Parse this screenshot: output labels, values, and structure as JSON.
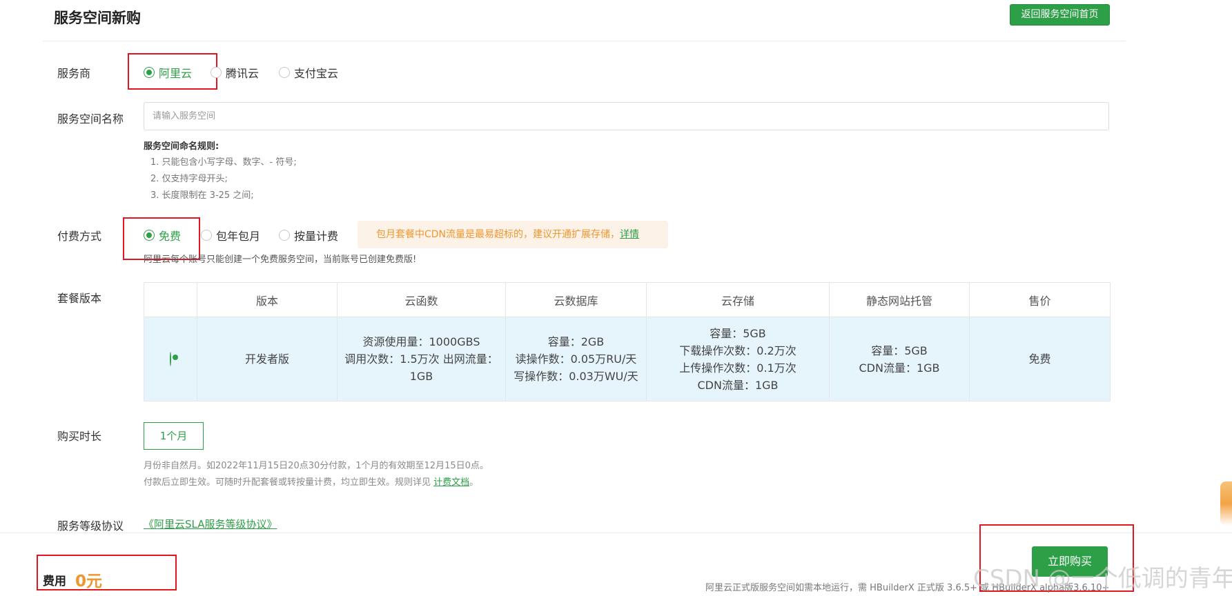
{
  "header": {
    "title": "服务空间新购",
    "back_button": "返回服务空间首页"
  },
  "provider": {
    "label": "服务商",
    "options": [
      "阿里云",
      "腾讯云",
      "支付宝云"
    ],
    "selected": "阿里云"
  },
  "space_name": {
    "label": "服务空间名称",
    "placeholder": "请输入服务空间",
    "value": "",
    "rules_title": "服务空间命名规则:",
    "rules": [
      "1. 只能包含小写字母、数字、- 符号;",
      "2. 仅支持字母开头;",
      "3. 长度限制在 3-25 之间;"
    ]
  },
  "payment": {
    "label": "付费方式",
    "options": [
      "免费",
      "包年包月",
      "按量计费"
    ],
    "selected": "免费",
    "notice": "包月套餐中CDN流量是最易超标的，建议开通扩展存储，",
    "notice_link": "详情",
    "note": "阿里云每个账号只能创建一个免费服务空间，当前账号已创建免费版!"
  },
  "plans": {
    "label": "套餐版本",
    "headers": [
      "",
      "版本",
      "云函数",
      "云数据库",
      "云存储",
      "静态网站托管",
      "售价"
    ],
    "row": {
      "selected": true,
      "version": "开发者版",
      "cloud_function": [
        "资源使用量：1000GBS",
        "调用次数：1.5万次 出网流量：",
        "1GB"
      ],
      "cloud_db": [
        "容量：2GB",
        "读操作数：0.05万RU/天",
        "写操作数：0.03万WU/天"
      ],
      "cloud_storage": [
        "容量：5GB",
        "下载操作次数：0.2万次",
        "上传操作次数：0.1万次",
        "CDN流量：1GB"
      ],
      "static_hosting": [
        "容量：5GB",
        "CDN流量：1GB"
      ],
      "price": "免费"
    }
  },
  "duration": {
    "label": "购买时长",
    "option": "1个月",
    "note1": "月份非自然月。如2022年11月15日20点30分付款，1个月的有效期至12月15日0点。",
    "note2_prefix": "付款后立即生效。可随时升配套餐或转按量计费，均立即生效。规则详见 ",
    "note2_link": "计费文档",
    "note2_suffix": "。"
  },
  "sla": {
    "label": "服务等级协议",
    "link": "《阿里云SLA服务等级协议》"
  },
  "footer": {
    "fee_label": "费用",
    "fee_amount": "0元",
    "buy_button": "立即购买",
    "note": "阿里云正式版服务空间如需本地运行，需 HBuilderX 正式版 3.6.5+ 或 HBuilderX alpha版3.6.10+",
    "watermark": "CSDN @一个低调的青年"
  },
  "colors": {
    "accent": "#2d9f47",
    "warning": "#f0962e",
    "highlight_box": "#e4151f",
    "table_row_bg": "#e6f5fc"
  }
}
